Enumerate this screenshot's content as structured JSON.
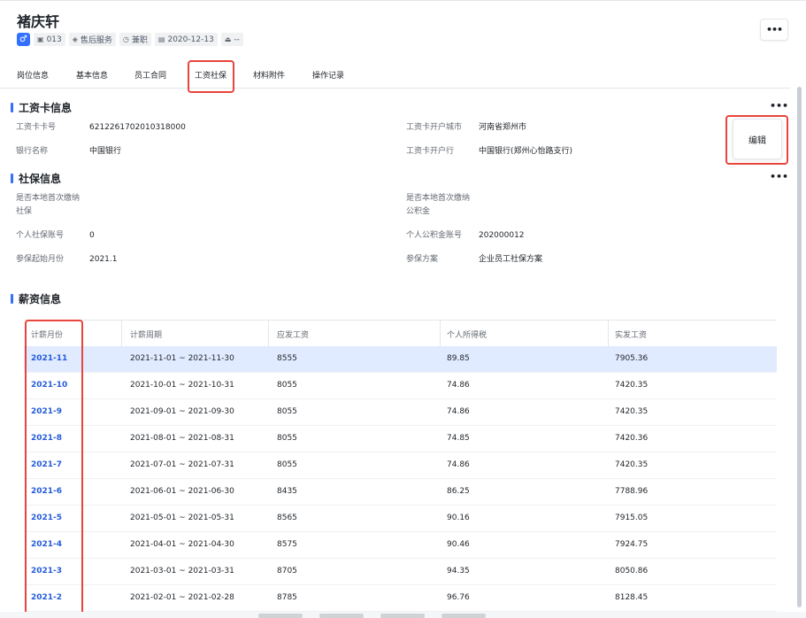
{
  "employee": {
    "name": "褚庆轩",
    "gender_icon": "male-icon",
    "tags": [
      {
        "icon": "id-card-icon",
        "text": "013"
      },
      {
        "icon": "layers-icon",
        "text": "售后服务"
      },
      {
        "icon": "clock-icon",
        "text": "兼职"
      },
      {
        "icon": "calendar-icon",
        "text": "2020-12-13"
      },
      {
        "icon": "stamp-icon",
        "text": "--"
      }
    ]
  },
  "header": {
    "more_label": "•••"
  },
  "tabs": [
    {
      "label": "岗位信息"
    },
    {
      "label": "基本信息"
    },
    {
      "label": "员工合同"
    },
    {
      "label": "工资社保",
      "active": true
    },
    {
      "label": "材料附件"
    },
    {
      "label": "操作记录"
    }
  ],
  "salary_card": {
    "title": "工资卡信息",
    "more_label": "•••",
    "edit_label": "编辑",
    "fields": [
      {
        "label": "工资卡卡号",
        "value": "6212261702010318000"
      },
      {
        "label": "工资卡开户城市",
        "value": "河南省郑州市"
      },
      {
        "label": "银行名称",
        "value": "中国银行"
      },
      {
        "label": "工资卡开户行",
        "value": "中国银行(郑州心怡路支行)"
      }
    ]
  },
  "social": {
    "title": "社保信息",
    "more_label": "•••",
    "fields": [
      {
        "label": "是否本地首次缴纳社保",
        "value": ""
      },
      {
        "label": "是否本地首次缴纳公积金",
        "value": ""
      },
      {
        "label": "个人社保账号",
        "value": "0"
      },
      {
        "label": "个人公积金账号",
        "value": "202000012"
      },
      {
        "label": "参保起始月份",
        "value": "2021.1"
      },
      {
        "label": "参保方案",
        "value": "企业员工社保方案"
      }
    ]
  },
  "salary": {
    "title": "薪资信息",
    "columns": [
      "计薪月份",
      "计薪周期",
      "应发工资",
      "个人所得税",
      "实发工资"
    ],
    "rows": [
      [
        "2021-11",
        "2021-11-01 ~ 2021-11-30",
        "8555",
        "89.85",
        "7905.36"
      ],
      [
        "2021-10",
        "2021-10-01 ~ 2021-10-31",
        "8055",
        "74.86",
        "7420.35"
      ],
      [
        "2021-9",
        "2021-09-01 ~ 2021-09-30",
        "8055",
        "74.86",
        "7420.35"
      ],
      [
        "2021-8",
        "2021-08-01 ~ 2021-08-31",
        "8055",
        "74.85",
        "7420.36"
      ],
      [
        "2021-7",
        "2021-07-01 ~ 2021-07-31",
        "8055",
        "74.86",
        "7420.35"
      ],
      [
        "2021-6",
        "2021-06-01 ~ 2021-06-30",
        "8435",
        "86.25",
        "7788.96"
      ],
      [
        "2021-5",
        "2021-05-01 ~ 2021-05-31",
        "8565",
        "90.16",
        "7915.05"
      ],
      [
        "2021-4",
        "2021-04-01 ~ 2021-04-30",
        "8575",
        "90.46",
        "7924.75"
      ],
      [
        "2021-3",
        "2021-03-01 ~ 2021-03-31",
        "8705",
        "94.35",
        "8050.86"
      ],
      [
        "2021-2",
        "2021-02-01 ~ 2021-02-28",
        "8785",
        "96.76",
        "8128.45"
      ]
    ]
  },
  "colors": {
    "accent": "#3370ff",
    "link": "#245bdb",
    "selected_row": "#e1ebff",
    "highlight": "#e8453c"
  }
}
